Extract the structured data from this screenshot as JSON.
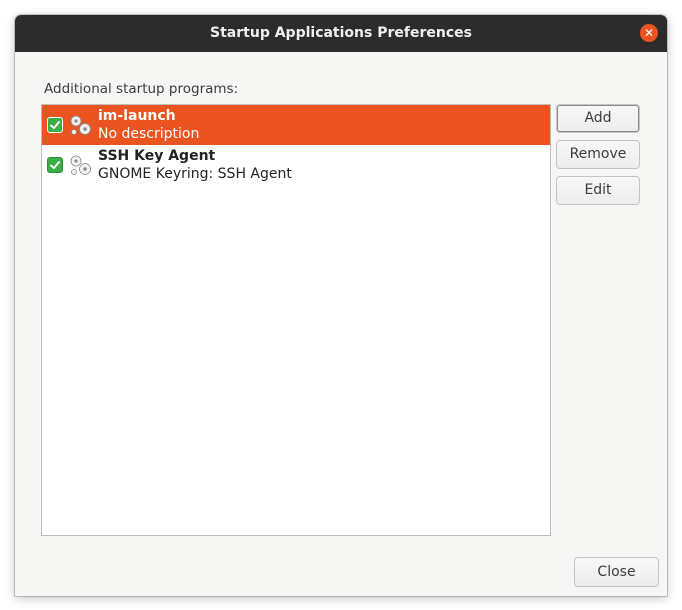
{
  "window": {
    "title": "Startup Applications Preferences"
  },
  "section_label": "Additional startup programs:",
  "programs": [
    {
      "name": "im-launch",
      "description": "No description",
      "enabled": true,
      "selected": true,
      "icon": "gears-icon"
    },
    {
      "name": "SSH Key Agent",
      "description": "GNOME Keyring: SSH Agent",
      "enabled": true,
      "selected": false,
      "icon": "gears-icon"
    }
  ],
  "buttons": {
    "add": "Add",
    "remove": "Remove",
    "edit": "Edit",
    "close": "Close"
  },
  "colors": {
    "accent": "#e95420",
    "checkbox": "#3cae47",
    "titlebar": "#2c2c2c"
  }
}
